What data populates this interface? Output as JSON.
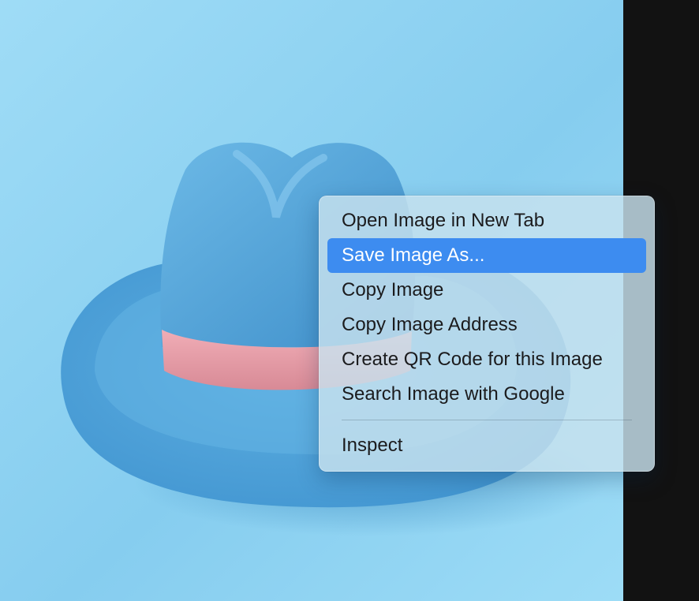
{
  "context_menu": {
    "items": [
      {
        "label": "Open Image in New Tab",
        "highlighted": false
      },
      {
        "label": "Save Image As...",
        "highlighted": true
      },
      {
        "label": "Copy Image",
        "highlighted": false
      },
      {
        "label": "Copy Image Address",
        "highlighted": false
      },
      {
        "label": "Create QR Code for this Image",
        "highlighted": false
      },
      {
        "label": "Search Image with Google",
        "highlighted": false
      }
    ],
    "footer_items": [
      {
        "label": "Inspect",
        "highlighted": false
      }
    ],
    "highlight_color": "#3d8cf0"
  },
  "image": {
    "subject_icon": "cowboy-hat-icon",
    "background_color": "#8fd2f2",
    "hat_color": "#5aa9dc",
    "band_color": "#e79aa6"
  },
  "page": {
    "backdrop_color": "#121212"
  }
}
